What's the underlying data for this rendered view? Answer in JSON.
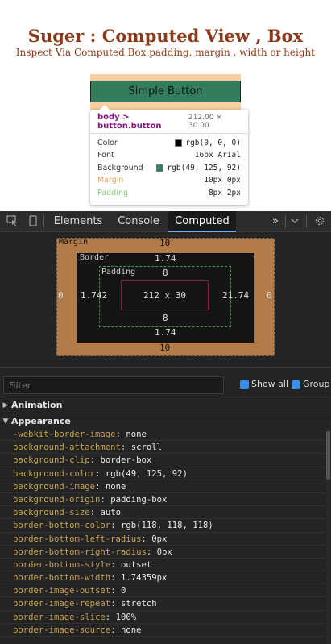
{
  "page": {
    "title": "Suger : Computed View , Box",
    "subtitle": "Inspect Via Computed Box padding, margin , width or height",
    "button_label": "Simple Button"
  },
  "tooltip": {
    "selector": "body > button.button",
    "dims": "212.00 × 30.00",
    "rows": [
      {
        "label": "Color",
        "value": "rgb(0, 0, 0)",
        "swatch": "#000000",
        "label_color": "#333333"
      },
      {
        "label": "Font",
        "value": "16px Arial",
        "swatch": "",
        "label_color": "#333333"
      },
      {
        "label": "Background",
        "value": "rgb(49, 125, 92)",
        "swatch": "#317d5c",
        "label_color": "#333333"
      },
      {
        "label": "Margin",
        "value": "10px 0px",
        "swatch": "",
        "label_color": "#f0a358"
      },
      {
        "label": "Padding",
        "value": "8px 2px",
        "swatch": "",
        "label_color": "#8bc87a"
      }
    ]
  },
  "devtools": {
    "tabs": [
      "Elements",
      "Console",
      "Computed"
    ],
    "active_tab": "Computed",
    "more": "»",
    "icons": [
      "inspect-icon",
      "device-icon",
      "more-tabs-icon",
      "chevron-down-icon",
      "gear-icon"
    ]
  },
  "boxmodel": {
    "margin_label": "Margin",
    "border_label": "Border",
    "padding_label": "Padding",
    "margin_top": "10",
    "margin_bottom": "10",
    "margin_left": "0",
    "margin_right": "0",
    "border_top": "1.74",
    "border_bottom": "1.74",
    "border_left": "1.742",
    "border_right": "21.74",
    "padding_top": "8",
    "padding_bottom": "8",
    "content": "212 x 30"
  },
  "filter": {
    "placeholder": "Filter",
    "show_all": "Show all",
    "group": "Group"
  },
  "sections": {
    "animation": "Animation",
    "appearance": "Appearance"
  },
  "properties": [
    {
      "name": "-webkit-border-image",
      "value": "none"
    },
    {
      "name": "background-attachment",
      "value": "scroll"
    },
    {
      "name": "background-clip",
      "value": "border-box"
    },
    {
      "name": "background-color",
      "value": "rgb(49, 125, 92)"
    },
    {
      "name": "background-image",
      "value": "none"
    },
    {
      "name": "background-origin",
      "value": "padding-box"
    },
    {
      "name": "background-size",
      "value": "auto"
    },
    {
      "name": "border-bottom-color",
      "value": "rgb(118, 118, 118)"
    },
    {
      "name": "border-bottom-left-radius",
      "value": "0px"
    },
    {
      "name": "border-bottom-right-radius",
      "value": "0px"
    },
    {
      "name": "border-bottom-style",
      "value": "outset"
    },
    {
      "name": "border-bottom-width",
      "value": "1.74359px"
    },
    {
      "name": "border-image-outset",
      "value": "0"
    },
    {
      "name": "border-image-repeat",
      "value": "stretch"
    },
    {
      "name": "border-image-slice",
      "value": "100%"
    },
    {
      "name": "border-image-source",
      "value": "none"
    }
  ],
  "colors": {
    "accent": "#7cacf8",
    "property_name": "#c5a24d",
    "title": "#8b3a1a"
  }
}
